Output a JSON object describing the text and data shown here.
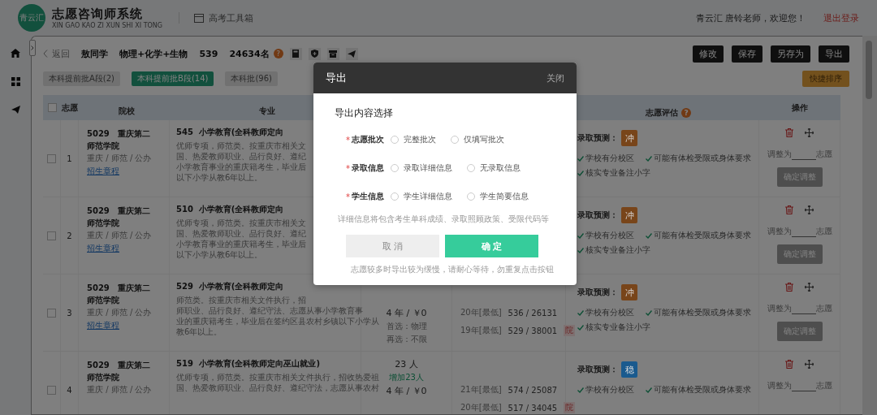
{
  "header": {
    "logo": "青云汇",
    "title": "志愿咨询师系统",
    "subtitle": "XIN GAO KAO ZI XUN SHI XI TONG",
    "toolbox": "高考工具箱",
    "welcome": "青云汇 唐铃老师，欢迎您！",
    "logout": "退出登录"
  },
  "toolbar": {
    "back": "返回",
    "student": "敖同学",
    "subjects": "物理+化学+生物",
    "score": "539",
    "rank": "24634名",
    "help": "?",
    "actions": [
      "修改",
      "保存",
      "另存为",
      "导出"
    ]
  },
  "tabs": [
    {
      "label": "本科提前批A段(2)",
      "selected": false
    },
    {
      "label": "本科提前批B段(14)",
      "selected": true
    },
    {
      "label": "本科批(96)",
      "selected": false
    }
  ],
  "sort_button": "快捷排序",
  "table": {
    "all_checked": false,
    "columns": [
      "志愿",
      "院校",
      "专业",
      "志愿评估",
      "操作"
    ],
    "eval_help": "?",
    "rows": [
      {
        "checked": false,
        "index": "1",
        "school": "5029　重庆第二师范学院",
        "school_meta": "重庆 / 师范 / 公办",
        "school_link": "招生章程",
        "major": "545  小学教育(全科教师定向",
        "major_desc": [
          "优师专项，师范类。按重庆市相关文",
          "国、热爱教师职业、品行良好、遵纪",
          "小学教育事业的重庆籍考生，毕业后",
          "以下小学从教6年以上。"
        ],
        "prediction_label": "录取预测：",
        "prediction": "冲",
        "color": "#78451a",
        "notes": [
          "学校有分校区",
          "可能有体检受限或身体要求",
          "核实专业备注小字"
        ],
        "adjust_prefix": "调整为",
        "adjust_suffix": "志愿",
        "adjust_button": "确定调整"
      },
      {
        "checked": false,
        "index": "2",
        "school": "5029　重庆第二师范学院",
        "school_meta": "重庆 / 师范 / 公办",
        "school_link": "招生章程",
        "major": "510  小学教育(全科教师定向",
        "major_desc": [
          "优师专项，师范类。按重庆市相关文",
          "国、热爱教师职业、品行良好、遵纪",
          "小学教育事业的重庆籍考生，毕业后",
          "以下小学从教6年以上。"
        ],
        "prediction_label": "录取预测：",
        "prediction": "冲",
        "color": "#78451a",
        "notes": [
          "学校有分校区",
          "可能有体检受限或身体要求",
          "核实专业备注小字"
        ],
        "adjust_prefix": "调整为",
        "adjust_suffix": "志愿",
        "adjust_button": "确定调整"
      },
      {
        "checked": false,
        "index": "3",
        "school": "5029　重庆第二师范学院",
        "school_meta": "重庆 / 师范 / 公办",
        "school_link": "招生章程",
        "major": "529  小学教育(全科教师定向",
        "major_desc": [
          "师范类。按重庆市相关文件执行，招",
          "师职业、品行良好、遵纪守法、志愿从事小学教育事",
          "业的重庆籍考生，毕业后在签约区县农村乡镇以下小学从",
          "教6年以上。"
        ],
        "plan": [
          {
            "kind": "duration",
            "text": "4 年 / ￥0"
          },
          {
            "kind": "subject",
            "text": "首选：物理"
          },
          {
            "kind": "subject",
            "text": "再选：不限"
          }
        ],
        "history": [
          {
            "year": "20年[最低]",
            "value": "536 / 26131"
          },
          {
            "year": "19年[最低]",
            "value": "529 / 38001"
          }
        ],
        "history_tag": "院",
        "prediction_label": "录取预测：",
        "prediction": "冲",
        "color": "#78451a",
        "notes": [
          "学校有分校区",
          "可能有体检受限或身体要求",
          "核实专业备注小字"
        ],
        "adjust_prefix": "调整为",
        "adjust_suffix": "志愿",
        "adjust_button": "确定调整"
      },
      {
        "checked": false,
        "index": "4",
        "school": "5029　重庆第二师范学院",
        "school_meta": "重庆 / 师范 / 公办",
        "major": "519  小学教育(全科教师定向巫山就业)",
        "major_desc": [
          "优师专项，师范类。按重庆市相关文件执行，招收热爱祖",
          "国、热爱教师职业、品行良好、遵纪守法，志愿从事农村"
        ],
        "plan": [
          {
            "kind": "count",
            "text": "23 人"
          },
          {
            "kind": "change",
            "text": "增加23人"
          },
          {
            "kind": "duration",
            "text": "4 年 / ￥0"
          }
        ],
        "history": [
          {
            "year": "21年[最低]",
            "value": "574 / 25087"
          },
          {
            "year": "20年[最低]",
            "value": "517 / 34045"
          }
        ],
        "history_tag": "院",
        "prediction_label": "录取预测：",
        "prediction": "稳",
        "color": "#1a5a8e",
        "notes": [
          "学校有分校区",
          "可能有体检受限或身体要求"
        ],
        "adjust_prefix": "调整为",
        "adjust_suffix": "志愿"
      }
    ]
  },
  "dialog": {
    "title": "导出",
    "close": "关闭",
    "heading": "导出内容选择",
    "groups": [
      {
        "label": "志愿批次",
        "options": [
          {
            "label": "完整批次",
            "selected": false
          },
          {
            "label": "仅填写批次",
            "selected": false
          }
        ]
      },
      {
        "label": "录取信息",
        "options": [
          {
            "label": "录取详细信息",
            "selected": false
          },
          {
            "label": "无录取信息",
            "selected": false
          }
        ]
      },
      {
        "label": "学生信息",
        "options": [
          {
            "label": "学生详细信息",
            "selected": false
          },
          {
            "label": "学生简要信息",
            "selected": false
          }
        ]
      }
    ],
    "required_mark": "*",
    "hint": "详细信息将包含考生单科成绩、录取照顾政策、受限代码等",
    "cancel": "取 消",
    "confirm": "确 定",
    "footer": "志愿较多时导出较为缓慢，请耐心等待，勿重复点击按钮"
  }
}
